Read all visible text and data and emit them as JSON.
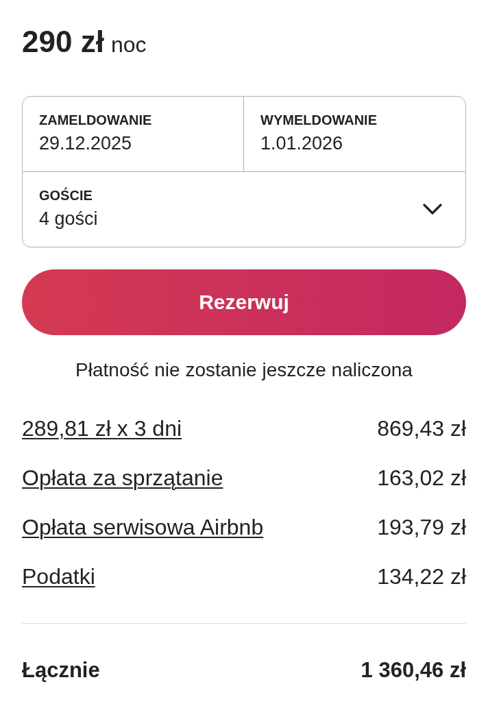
{
  "price": {
    "amount": "290 zł",
    "unit": "noc"
  },
  "booking_fields": {
    "check_in": {
      "label": "ZAMELDOWANIE",
      "value": "29.12.2025"
    },
    "check_out": {
      "label": "WYMELDOWANIE",
      "value": "1.01.2026"
    },
    "guests": {
      "label": "GOŚCIE",
      "value": "4 gości"
    }
  },
  "reserve_button": {
    "label": "Rezerwuj"
  },
  "note": "Płatność nie zostanie jeszcze naliczona",
  "price_breakdown": [
    {
      "label": "289,81 zł x 3 dni",
      "amount": "869,43 zł"
    },
    {
      "label": "Opłata za sprzątanie",
      "amount": "163,02 zł"
    },
    {
      "label": "Opłata serwisowa Airbnb",
      "amount": "193,79 zł"
    },
    {
      "label": "Podatki",
      "amount": "134,22 zł"
    }
  ],
  "total": {
    "label": "Łącznie",
    "amount": "1 360,46 zł"
  }
}
